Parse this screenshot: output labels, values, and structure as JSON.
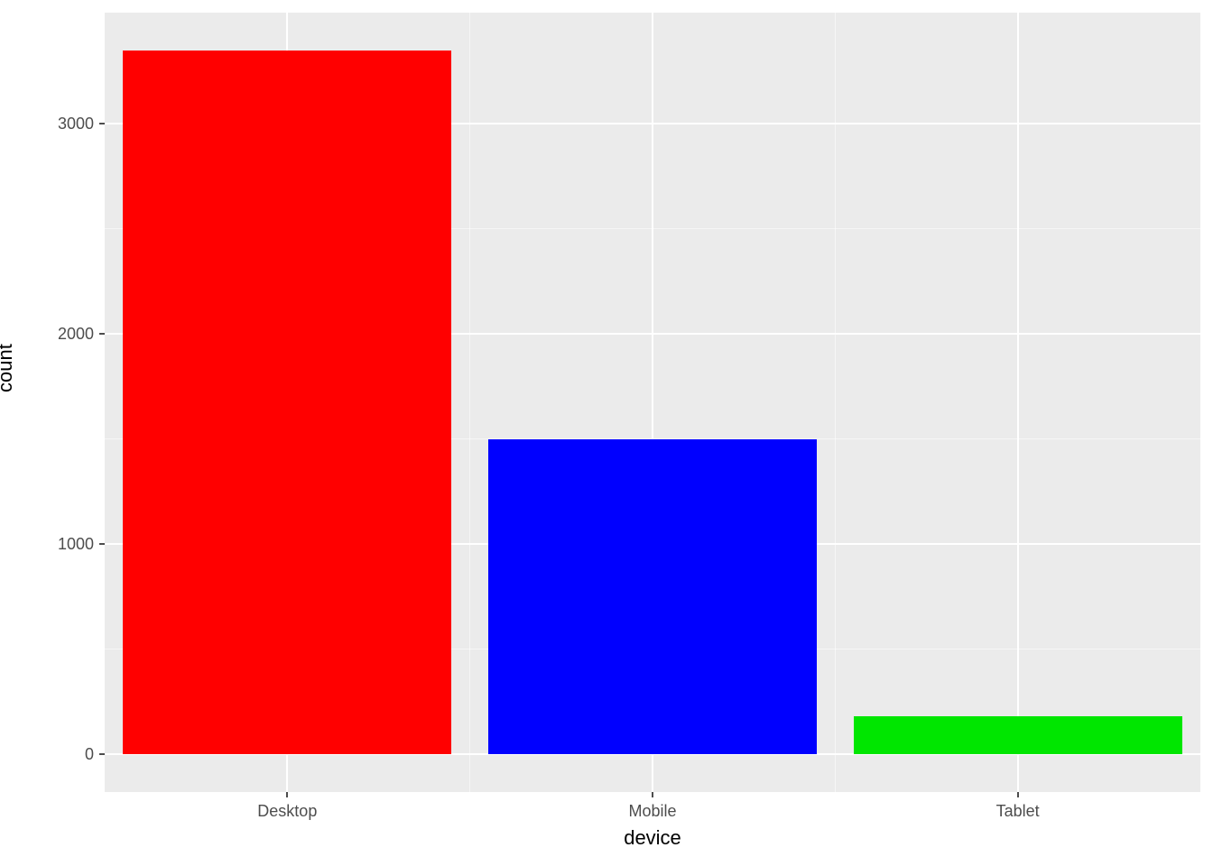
{
  "chart_data": {
    "type": "bar",
    "categories": [
      "Desktop",
      "Mobile",
      "Tablet"
    ],
    "values": [
      3350,
      1500,
      180
    ],
    "colors": [
      "#ff0000",
      "#0000ff",
      "#00e600"
    ],
    "xlabel": "device",
    "ylabel": "count",
    "y_ticks": [
      0,
      1000,
      2000,
      3000
    ],
    "ylim": [
      -180,
      3530
    ]
  }
}
